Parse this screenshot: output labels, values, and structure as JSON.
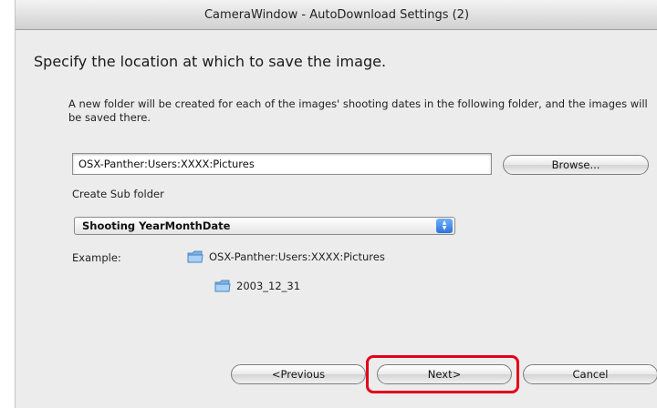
{
  "window": {
    "title": "CameraWindow - AutoDownload Settings (2)"
  },
  "main": {
    "heading": "Specify the location at which to save the image.",
    "description": "A new folder will be created for each of the images' shooting dates in the following folder, and the images will be saved there.",
    "path_value": "OSX-Panther:Users:XXXX:Pictures",
    "browse_label": "Browse...",
    "subfolder_label": "Create Sub folder",
    "subfolder_selected": "Shooting YearMonthDate",
    "example_label": "Example:",
    "example_path": "OSX-Panther:Users:XXXX:Pictures",
    "example_subfolder": "2003_12_31"
  },
  "footer": {
    "previous_label": "<Previous",
    "next_label": "Next>",
    "cancel_label": "Cancel"
  },
  "colors": {
    "highlight": "#e2001a",
    "select_arrow": "#2e73d8"
  },
  "icons": {
    "folder": "folder-icon",
    "select_arrows": "up-down-arrows-icon"
  }
}
